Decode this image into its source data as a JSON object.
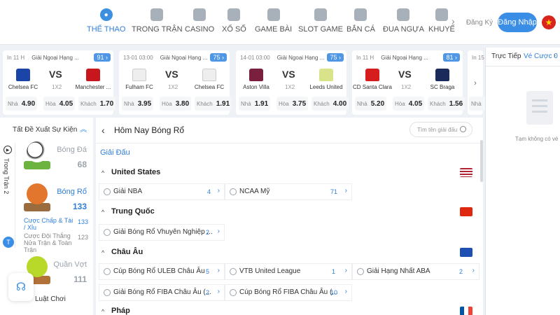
{
  "nav": {
    "items": [
      {
        "label": "THỂ THAO",
        "icon": "soccer-ball-icon",
        "active": true
      },
      {
        "label": "TRONG TRẬN",
        "icon": "video-icon"
      },
      {
        "label": "CASINO",
        "icon": "cards-icon"
      },
      {
        "label": "XỔ SỐ",
        "icon": "lottery-icon"
      },
      {
        "label": "GAME BÀI",
        "icon": "card-game-icon"
      },
      {
        "label": "SLOT GAME",
        "icon": "slot-machine-icon"
      },
      {
        "label": "BẮN CÁ",
        "icon": "fish-icon"
      },
      {
        "label": "ĐUA NGỰA",
        "icon": "horse-icon"
      },
      {
        "label": "KHUYẾ",
        "icon": "gift-icon"
      }
    ],
    "register": "Đăng Ký",
    "login": "Đăng Nhập",
    "more_arrow": "›"
  },
  "matches": [
    {
      "time": "In 11 H",
      "league": "Giải Ngoại Hạng ...",
      "badge": "91 ›",
      "home": "Chelsea FC",
      "away": "Manchester ...",
      "vs": "VS",
      "market": "1X2",
      "home_color": "#1b44a8",
      "away_color": "#c8161d",
      "odds": [
        {
          "k": "Nhà",
          "v": "4.90"
        },
        {
          "k": "Hòa",
          "v": "4.05"
        },
        {
          "k": "Khách",
          "v": "1.70"
        }
      ]
    },
    {
      "time": "13-01 03:00",
      "league": "Giải Ngoại Hạng ...",
      "badge": "75 ›",
      "home": "Fulham FC",
      "away": "Chelsea FC",
      "vs": "VS",
      "market": "1X2",
      "home_color": "#eeeeee",
      "away_color": "#eeeeee",
      "odds": [
        {
          "k": "Nhà",
          "v": "3.95"
        },
        {
          "k": "Hòa",
          "v": "3.80"
        },
        {
          "k": "Khách",
          "v": "1.91"
        }
      ]
    },
    {
      "time": "14-01 03:00",
      "league": "Giải Ngoại Hạng ...",
      "badge": "75 ›",
      "home": "Aston Villa",
      "away": "Leeds United",
      "vs": "VS",
      "market": "1X2",
      "home_color": "#7a1f3d",
      "away_color": "#d9e48a",
      "odds": [
        {
          "k": "Nhà",
          "v": "1.91"
        },
        {
          "k": "Hòa",
          "v": "3.75"
        },
        {
          "k": "Khách",
          "v": "4.00"
        }
      ]
    },
    {
      "time": "In 11 H",
      "league": "Giải Ngoại Hạng ...",
      "badge": "81 ›",
      "home": "CD Santa Clara",
      "away": "SC Braga",
      "vs": "VS",
      "market": "1X2",
      "home_color": "#d61d1d",
      "away_color": "#1a2a5a",
      "odds": [
        {
          "k": "Nhà",
          "v": "5.20"
        },
        {
          "k": "Hòa",
          "v": "4.05"
        },
        {
          "k": "Khách",
          "v": "1.56"
        }
      ]
    },
    {
      "time": "In 15",
      "league": "",
      "badge": "",
      "home": "",
      "away": "",
      "vs": "",
      "market": "",
      "home_color": "#ffffff",
      "away_color": "#ffffff",
      "odds": [
        {
          "k": "Nhà",
          "v": ""
        }
      ]
    }
  ],
  "strip_next": "›",
  "right_panel": {
    "tab1": "Trực Tiếp",
    "tab2": "Vé Cược",
    "tab2_count": "0",
    "scroll": "›",
    "empty": "Tạm không có vé cư"
  },
  "sidebar": {
    "header": "Tất Đề Xuất Sự Kiện",
    "header_chevron": "︽",
    "vertical_tab": "Trong Trận",
    "vertical_count": "2",
    "vertical_badge": "T",
    "sports": [
      {
        "name": "Bóng Đá",
        "count": "68"
      },
      {
        "name": "Bóng Rổ",
        "count": "133"
      },
      {
        "name": "Quần Vợt",
        "count": "111"
      }
    ],
    "subitems": [
      {
        "label": "Cược Chấp & Tài / Xỉu",
        "count": "133"
      },
      {
        "label": "Cược Đội Thắng Nửa Trận & Toàn Trận",
        "count": "123"
      }
    ],
    "help_icon": "headset-icon",
    "rules": "Luật Chơi"
  },
  "main": {
    "back": "‹",
    "title": "Hôm Nay Bóng Rổ",
    "search_placeholder": "Tìm tên giải đấu",
    "section": "Giải Đấu",
    "regions": [
      {
        "name": "United States",
        "flag_color": "#b22234",
        "caret": "^",
        "leagues": [
          {
            "name": "Giải NBA",
            "count": "4",
            "arrow": "›"
          },
          {
            "name": "NCAA Mỹ",
            "count": "71",
            "arrow": "›"
          }
        ]
      },
      {
        "name": "Trung Quốc",
        "flag_color": "#de2910",
        "caret": "^",
        "leagues": [
          {
            "name": "Giải Bóng Rổ Vhuyên Nghiệp ...",
            "count": "2",
            "arrow": "›"
          }
        ]
      },
      {
        "name": "Châu Âu",
        "flag_color": "#1e4fb3",
        "caret": "^",
        "leagues": [
          {
            "name": "Cúp Bóng Rổ ULEB Châu Âu",
            "count": "5",
            "arrow": "›"
          },
          {
            "name": "VTB United League",
            "count": "1",
            "arrow": "›"
          },
          {
            "name": "Giải Hạng Nhất ABA",
            "count": "2",
            "arrow": "›"
          },
          {
            "name": "Giải Bóng Rổ FIBA Châu Âu (...",
            "count": "2",
            "arrow": "›"
          },
          {
            "name": "Cúp Bóng Rổ FIBA Châu Âu (...",
            "count": "10",
            "arrow": "›"
          }
        ]
      },
      {
        "name": "Pháp",
        "flag_color": "#0055a4",
        "caret": "^",
        "leagues": []
      }
    ]
  }
}
